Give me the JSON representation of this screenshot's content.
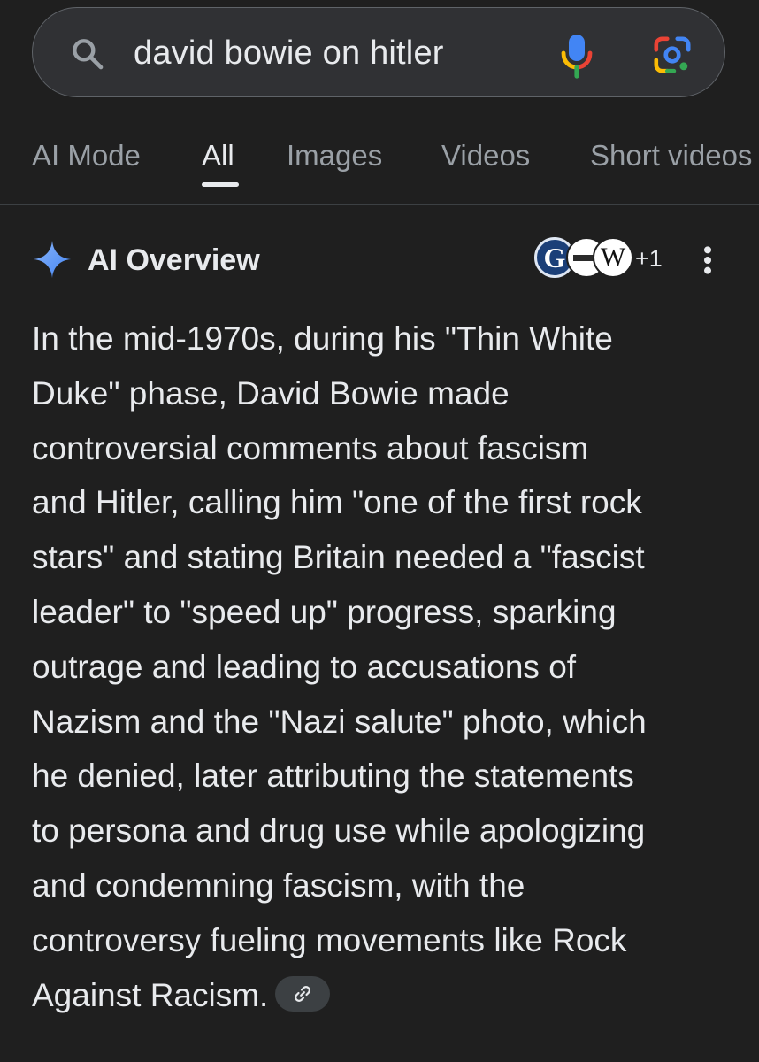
{
  "search": {
    "query": "david bowie on hitler",
    "icons": [
      "search-icon",
      "microphone-icon",
      "google-lens-icon"
    ]
  },
  "tabs": [
    {
      "label": "AI Mode",
      "active": false
    },
    {
      "label": "All",
      "active": true
    },
    {
      "label": "Images",
      "active": false
    },
    {
      "label": "Videos",
      "active": false
    },
    {
      "label": "Short videos",
      "active": false
    }
  ],
  "ai_overview": {
    "title": "AI Overview",
    "sources": {
      "icons": [
        "guardian-favicon",
        "source-favicon",
        "wikipedia-favicon"
      ],
      "guardian_letter": "G",
      "wikipedia_letter": "W",
      "extra_count": "+1"
    },
    "lines": [
      "In the mid-1970s, during his \"Thin White",
      "Duke\" phase, David Bowie made",
      "controversial comments about fascism",
      "and Hitler, calling him \"one of the first rock",
      "stars\" and stating Britain needed a \"fascist",
      "leader\" to \"speed up\" progress, sparking",
      "outrage and leading to accusations of",
      "Nazism and the \"Nazi salute\" photo, which",
      "he denied, later attributing the statements",
      "to persona and drug use while apologizing",
      "and condemning fascism, with the",
      "controversy fueling movements like Rock",
      "Against Racism."
    ]
  },
  "colors": {
    "background": "#1f1f1f",
    "search_bar": "#303134",
    "text_primary": "#e8eaed",
    "text_secondary": "#9aa0a6",
    "google_blue": "#4285f4",
    "google_red": "#ea4335",
    "google_yellow": "#fbbc05",
    "google_green": "#34a853"
  }
}
